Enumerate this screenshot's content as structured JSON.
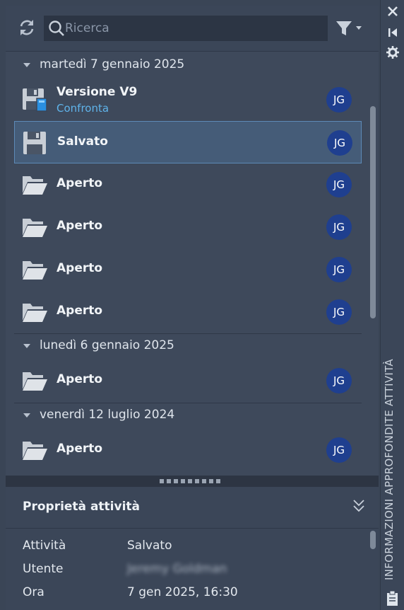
{
  "toolbar": {
    "refresh_icon": "refresh-icon",
    "search_placeholder": "Ricerca",
    "search_value": "",
    "filter_icon": "filter-icon"
  },
  "groups": [
    {
      "date": "martedì 7 gennaio 2025",
      "items": [
        {
          "title": "Versione V9",
          "subtitle": "Confronta",
          "icon": "version-save-icon",
          "user": "JG"
        },
        {
          "title": "Salvato",
          "subtitle": "",
          "icon": "save-icon",
          "user": "JG",
          "selected": true
        },
        {
          "title": "Aperto",
          "icon": "folder-open-icon",
          "user": "JG"
        },
        {
          "title": "Aperto",
          "icon": "folder-open-icon",
          "user": "JG"
        },
        {
          "title": "Aperto",
          "icon": "folder-open-icon",
          "user": "JG"
        },
        {
          "title": "Aperto",
          "icon": "folder-open-icon",
          "user": "JG"
        }
      ]
    },
    {
      "date": "lunedì 6 gennaio 2025",
      "items": [
        {
          "title": "Aperto",
          "icon": "folder-open-icon",
          "user": "JG"
        }
      ]
    },
    {
      "date": "venerdì 12 luglio 2024",
      "items": [
        {
          "title": "Aperto",
          "icon": "folder-open-icon",
          "user": "JG"
        }
      ]
    }
  ],
  "properties": {
    "title": "Proprietà attività",
    "rows": [
      {
        "label": "Attività",
        "value": "Salvato"
      },
      {
        "label": "Utente",
        "value": "Jeremy Goldman"
      },
      {
        "label": "Ora",
        "value": "7 gen 2025, 16:30"
      }
    ]
  },
  "side_rail": {
    "label": "INFORMAZIONI APPROFONDITE ATTIVITÀ",
    "icons": [
      "close-icon",
      "skip-back-icon",
      "settings-icon",
      "clipboard-icon"
    ]
  },
  "colors": {
    "background": "#3b4658",
    "selected_bg": "#455c78",
    "selected_border": "#5d8ab7",
    "link": "#5fb3ea",
    "avatar": "#1f3f8f"
  }
}
